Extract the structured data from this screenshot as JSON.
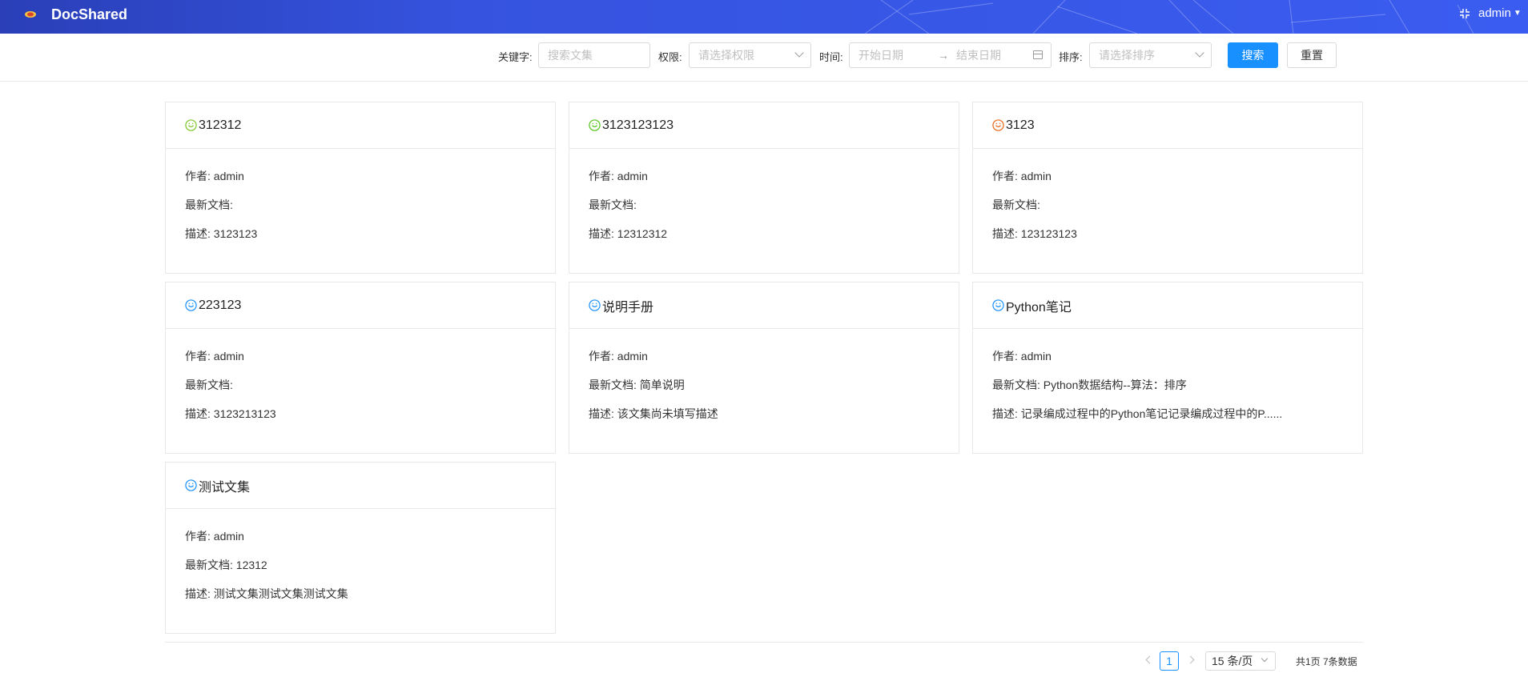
{
  "header": {
    "app_title": "DocShared",
    "user": "admin"
  },
  "filters": {
    "keyword_label": "关键字:",
    "keyword_placeholder": "搜索文集",
    "permission_label": "权限:",
    "permission_placeholder": "请选择权限",
    "time_label": "时间:",
    "start_date_placeholder": "开始日期",
    "end_date_placeholder": "结束日期",
    "sort_label": "排序:",
    "sort_placeholder": "请选择排序",
    "search_button": "搜索",
    "reset_button": "重置"
  },
  "card_labels": {
    "author": "作者:",
    "latest_doc": "最新文档:",
    "description": "描述:"
  },
  "cards": [
    {
      "title": "312312",
      "author": "admin",
      "latest_doc": "",
      "description": "3123123",
      "icon_color": "#7cc62a"
    },
    {
      "title": "3123123123",
      "author": "admin",
      "latest_doc": "",
      "description": "12312312",
      "icon_color": "#52c41a"
    },
    {
      "title": "3123",
      "author": "admin",
      "latest_doc": "",
      "description": "123123123",
      "icon_color": "#e8681a"
    },
    {
      "title": "223123",
      "author": "admin",
      "latest_doc": "",
      "description": "3123213123",
      "icon_color": "#1890ff"
    },
    {
      "title": "说明手册",
      "author": "admin",
      "latest_doc": "简单说明",
      "description": "该文集尚未填写描述",
      "icon_color": "#1890ff"
    },
    {
      "title": "Python笔记",
      "author": "admin",
      "latest_doc": "Python数据结构--算法：排序",
      "description": "记录编成过程中的Python笔记记录编成过程中的P......",
      "icon_color": "#1890ff"
    },
    {
      "title": "测试文集",
      "author": "admin",
      "latest_doc": "12312",
      "description": "测试文集测试文集测试文集",
      "icon_color": "#1890ff"
    }
  ],
  "pagination": {
    "current_page": "1",
    "page_size": "15 条/页",
    "total_text": "共1页 7条数据"
  },
  "colors": {
    "header": "#3553de",
    "primary": "#1890ff"
  }
}
